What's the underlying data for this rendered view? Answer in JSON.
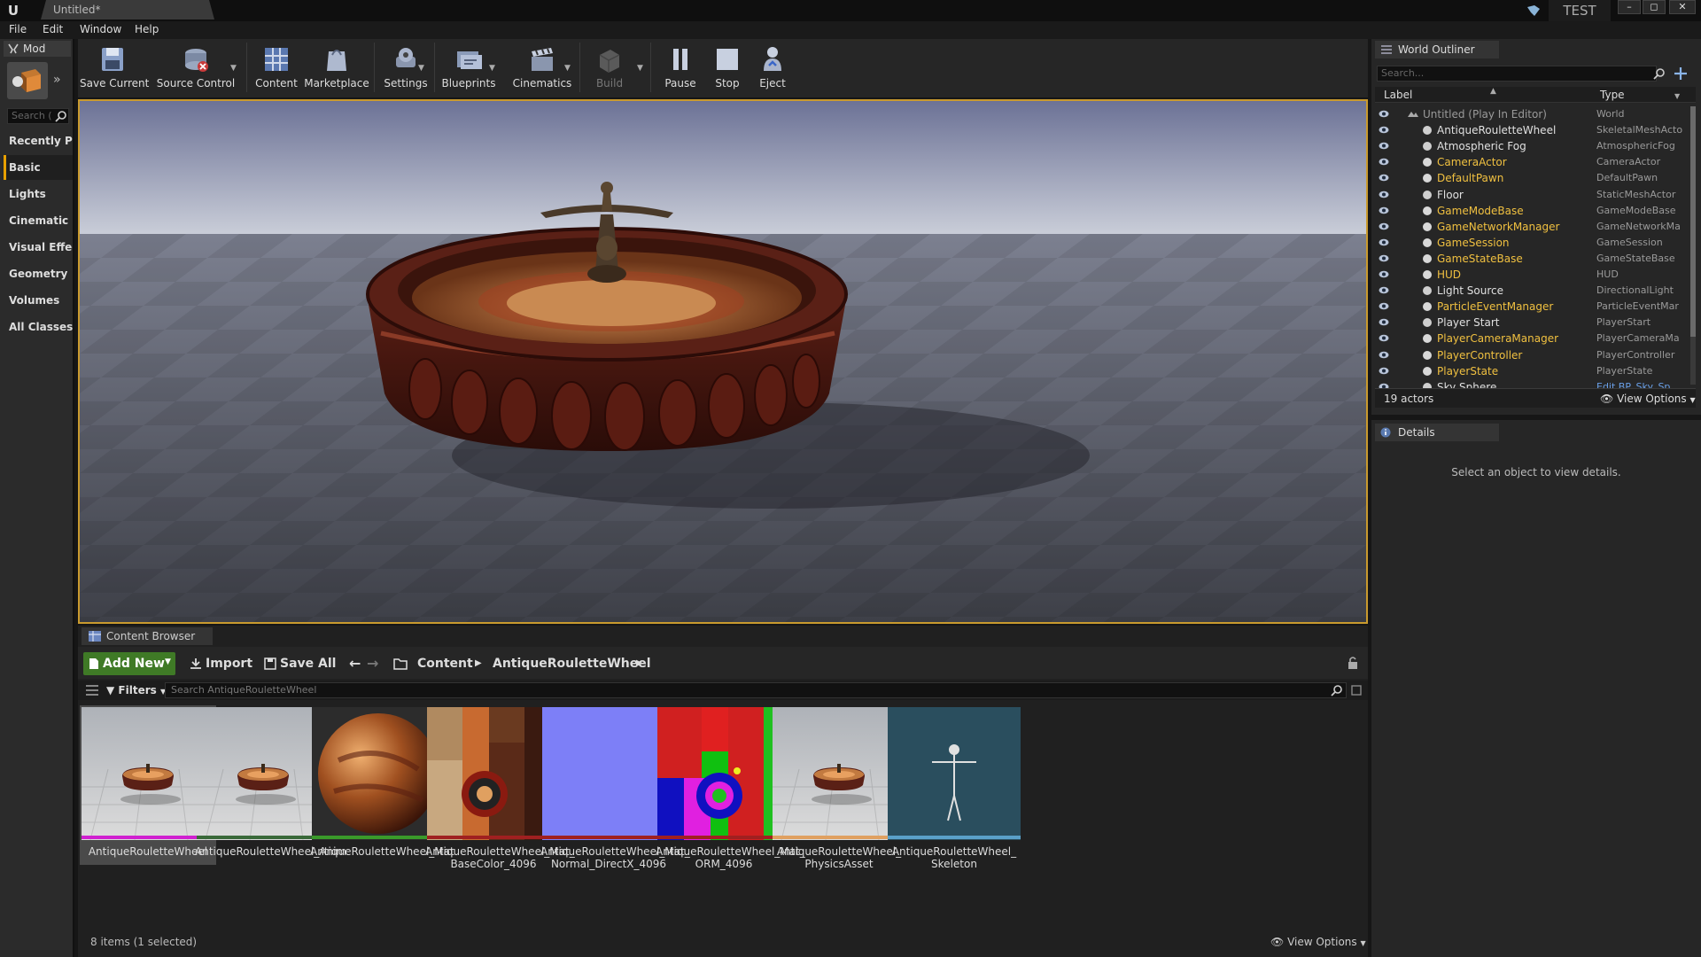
{
  "window": {
    "tab_title": "Untitled*",
    "badge": "TEST",
    "controls": [
      "–",
      "◻",
      "✕"
    ]
  },
  "menu": [
    "File",
    "Edit",
    "Window",
    "Help"
  ],
  "modes": {
    "tab_label": "Mod",
    "search_placeholder": "Search (",
    "categories": [
      "Recently Pla",
      "Basic",
      "Lights",
      "Cinematic",
      "Visual Effect",
      "Geometry",
      "Volumes",
      "All Classes"
    ],
    "active_category": "Basic"
  },
  "toolbar": {
    "buttons": [
      {
        "label": "Save Current",
        "icon": "save-icon"
      },
      {
        "label": "Source Control",
        "icon": "source-control-icon"
      },
      {
        "label": "Content",
        "icon": "content-icon"
      },
      {
        "label": "Marketplace",
        "icon": "marketplace-icon"
      },
      {
        "label": "Settings",
        "icon": "settings-icon"
      },
      {
        "label": "Blueprints",
        "icon": "blueprints-icon"
      },
      {
        "label": "Cinematics",
        "icon": "cinematics-icon"
      },
      {
        "label": "Build",
        "icon": "build-icon"
      },
      {
        "label": "Pause",
        "icon": "pause-icon"
      },
      {
        "label": "Stop",
        "icon": "stop-icon"
      },
      {
        "label": "Eject",
        "icon": "eject-icon"
      }
    ]
  },
  "content_browser": {
    "tab_label": "Content Browser",
    "add_new": "Add New",
    "import": "Import",
    "save_all": "Save All",
    "path": [
      "Content",
      "AntiqueRouletteWheel"
    ],
    "filters": "Filters",
    "search_placeholder": "Search AntiqueRouletteWheel",
    "assets": [
      {
        "name": "AntiqueRouletteWheel",
        "color": "#d020d0",
        "thumb": "mesh",
        "selected": true
      },
      {
        "name": "AntiqueRouletteWheel_Anim",
        "color": "#3a6a3a",
        "thumb": "mesh"
      },
      {
        "name": "AntiqueRouletteWheel_Mat",
        "color": "#3a9a2a",
        "thumb": "sphere"
      },
      {
        "name": "AntiqueRouletteWheel_Mat_\nBaseColor_4096",
        "color": "#a02020",
        "thumb": "basecolor"
      },
      {
        "name": "AntiqueRouletteWheel_Mat_\nNormal_DirectX_4096",
        "color": "#a02020",
        "thumb": "normal"
      },
      {
        "name": "AntiqueRouletteWheel_Mat_\nORM_4096",
        "color": "#a02020",
        "thumb": "orm"
      },
      {
        "name": "AntiqueRouletteWheel_\nPhysicsAsset",
        "color": "#e0a060",
        "thumb": "mesh"
      },
      {
        "name": "AntiqueRouletteWheel_\nSkeleton",
        "color": "#5aa0c8",
        "thumb": "skeleton"
      }
    ],
    "status": "8 items (1 selected)",
    "view_options": "View Options"
  },
  "world_outliner": {
    "tab_label": "World Outliner",
    "search_placeholder": "Search...",
    "col_label": "Label",
    "col_type": "Type",
    "rows": [
      {
        "label": "Untitled (Play In Editor)",
        "type": "World",
        "kind": "world"
      },
      {
        "label": "AntiqueRouletteWheel",
        "type": "SkeletalMeshActo",
        "kind": "normal"
      },
      {
        "label": "Atmospheric Fog",
        "type": "AtmosphericFog",
        "kind": "normal"
      },
      {
        "label": "CameraActor",
        "type": "CameraActor",
        "kind": "spawned"
      },
      {
        "label": "DefaultPawn",
        "type": "DefaultPawn",
        "kind": "spawned"
      },
      {
        "label": "Floor",
        "type": "StaticMeshActor",
        "kind": "normal"
      },
      {
        "label": "GameModeBase",
        "type": "GameModeBase",
        "kind": "spawned"
      },
      {
        "label": "GameNetworkManager",
        "type": "GameNetworkMa",
        "kind": "spawned"
      },
      {
        "label": "GameSession",
        "type": "GameSession",
        "kind": "spawned"
      },
      {
        "label": "GameStateBase",
        "type": "GameStateBase",
        "kind": "spawned"
      },
      {
        "label": "HUD",
        "type": "HUD",
        "kind": "spawned"
      },
      {
        "label": "Light Source",
        "type": "DirectionalLight",
        "kind": "normal"
      },
      {
        "label": "ParticleEventManager",
        "type": "ParticleEventMar",
        "kind": "spawned"
      },
      {
        "label": "Player Start",
        "type": "PlayerStart",
        "kind": "normal"
      },
      {
        "label": "PlayerCameraManager",
        "type": "PlayerCameraMa",
        "kind": "spawned"
      },
      {
        "label": "PlayerController",
        "type": "PlayerController",
        "kind": "spawned"
      },
      {
        "label": "PlayerState",
        "type": "PlayerState",
        "kind": "spawned"
      },
      {
        "label": "Sky Sphere",
        "type": "Edit BP_Sky_Sp",
        "kind": "normal"
      }
    ],
    "actor_count": "19 actors",
    "view_options": "View Options"
  },
  "details": {
    "tab_label": "Details",
    "message": "Select an object to view details."
  },
  "colors": {
    "accent": "#e8a000",
    "spawned_label": "#f0c040",
    "viewport_border": "#c99a2e"
  }
}
